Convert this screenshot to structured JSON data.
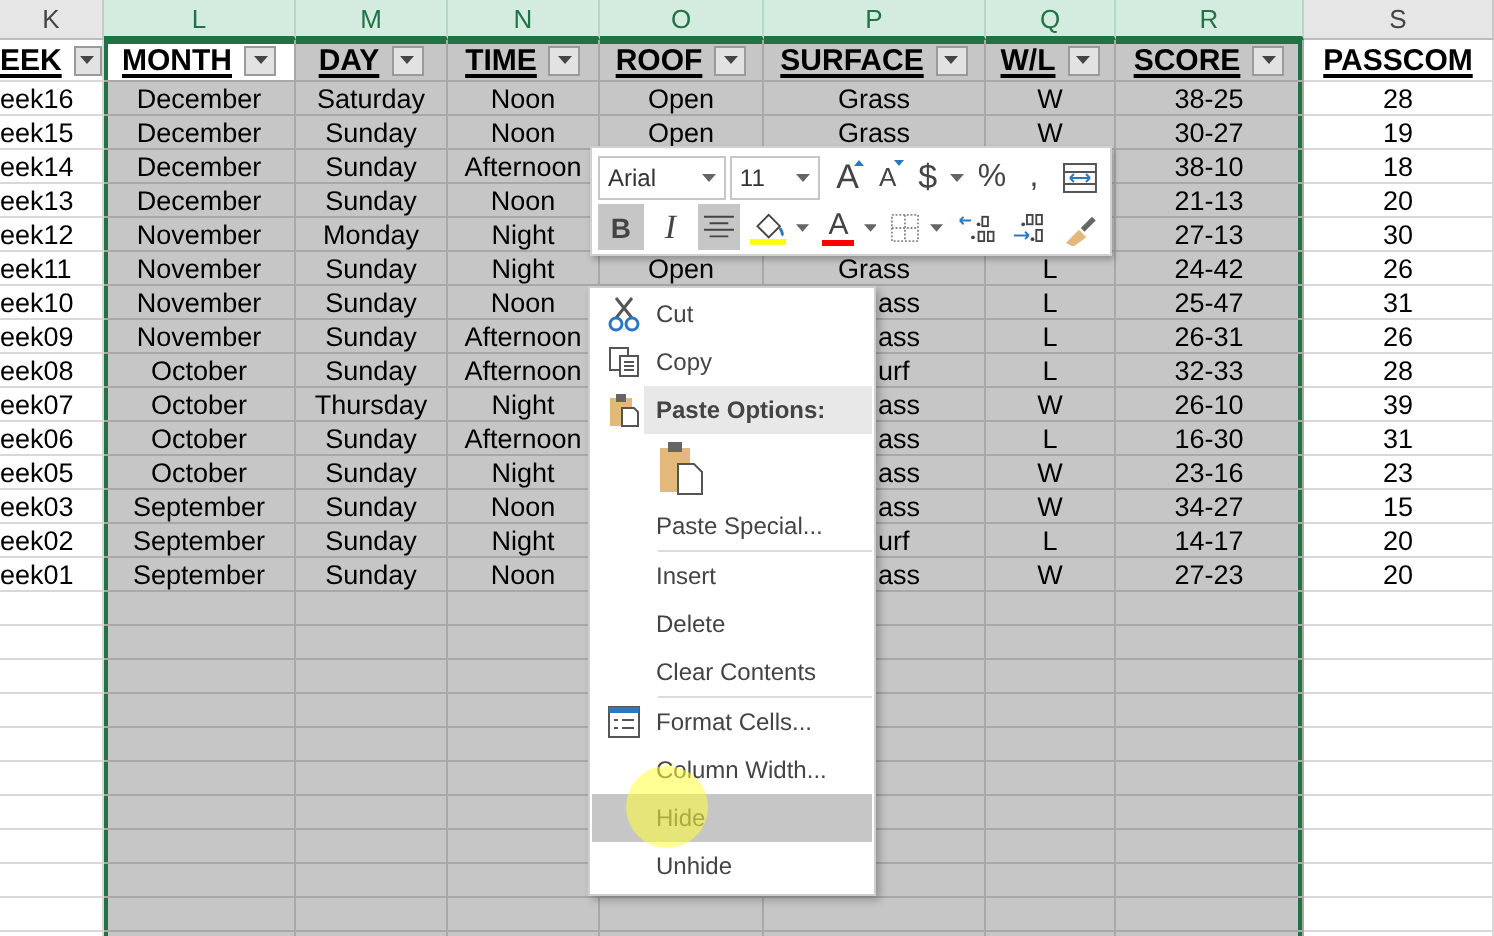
{
  "columns": [
    {
      "letter": "K",
      "selected": false
    },
    {
      "letter": "L",
      "selected": true
    },
    {
      "letter": "M",
      "selected": true
    },
    {
      "letter": "N",
      "selected": true
    },
    {
      "letter": "O",
      "selected": true
    },
    {
      "letter": "P",
      "selected": true
    },
    {
      "letter": "Q",
      "selected": true
    },
    {
      "letter": "R",
      "selected": true
    },
    {
      "letter": "S",
      "selected": false
    }
  ],
  "headers": [
    {
      "title": "EEK",
      "filter": true,
      "active": false
    },
    {
      "title": "MONTH",
      "filter": true,
      "active": true
    },
    {
      "title": "DAY",
      "filter": true,
      "active": false
    },
    {
      "title": "TIME",
      "filter": true,
      "active": false
    },
    {
      "title": "ROOF",
      "filter": true,
      "active": false
    },
    {
      "title": "SURFACE",
      "filter": true,
      "active": false
    },
    {
      "title": "W/L",
      "filter": true,
      "active": false
    },
    {
      "title": "SCORE",
      "filter": true,
      "active": false
    },
    {
      "title": "PASSCOM",
      "filter": false,
      "active": false
    }
  ],
  "rows": [
    [
      "eek16",
      "December",
      "Saturday",
      "Noon",
      "Open",
      "Grass",
      "W",
      "38-25",
      "28"
    ],
    [
      "eek15",
      "December",
      "Sunday",
      "Noon",
      "Open",
      "Grass",
      "W",
      "30-27",
      "19"
    ],
    [
      "eek14",
      "December",
      "Sunday",
      "Afternoon",
      "",
      "",
      "",
      "38-10",
      "18"
    ],
    [
      "eek13",
      "December",
      "Sunday",
      "Noon",
      "",
      "",
      "",
      "21-13",
      "20"
    ],
    [
      "eek12",
      "November",
      "Monday",
      "Night",
      "",
      "",
      "",
      "27-13",
      "30"
    ],
    [
      "eek11",
      "November",
      "Sunday",
      "Night",
      "Open",
      "Grass",
      "L",
      "24-42",
      "26"
    ],
    [
      "eek10",
      "November",
      "Sunday",
      "Noon",
      "",
      "ass",
      "L",
      "25-47",
      "31"
    ],
    [
      "eek09",
      "November",
      "Sunday",
      "Afternoon",
      "",
      "ass",
      "L",
      "26-31",
      "26"
    ],
    [
      "eek08",
      "October",
      "Sunday",
      "Afternoon",
      "",
      "urf",
      "L",
      "32-33",
      "28"
    ],
    [
      "eek07",
      "October",
      "Thursday",
      "Night",
      "",
      "ass",
      "W",
      "26-10",
      "39"
    ],
    [
      "eek06",
      "October",
      "Sunday",
      "Afternoon",
      "",
      "ass",
      "L",
      "16-30",
      "31"
    ],
    [
      "eek05",
      "October",
      "Sunday",
      "Night",
      "",
      "ass",
      "W",
      "23-16",
      "23"
    ],
    [
      "eek03",
      "September",
      "Sunday",
      "Noon",
      "",
      "ass",
      "W",
      "34-27",
      "15"
    ],
    [
      "eek02",
      "September",
      "Sunday",
      "Night",
      "",
      "urf",
      "L",
      "14-17",
      "20"
    ],
    [
      "eek01",
      "September",
      "Sunday",
      "Noon",
      "",
      "ass",
      "W",
      "27-23",
      "20"
    ]
  ],
  "mini_toolbar": {
    "font": "Arial",
    "size": "11",
    "row_1": [
      {
        "kind": "grow",
        "text": "A",
        "selected": false
      },
      {
        "kind": "shrink",
        "text": "A",
        "selected": false
      },
      {
        "kind": "currency",
        "text": "$",
        "selected": false
      },
      {
        "kind": "glyph",
        "text": "%",
        "selected": false
      },
      {
        "kind": "glyph",
        "text": ",",
        "selected": false
      },
      {
        "kind": "wrap",
        "selected": false
      }
    ],
    "row_2": [
      {
        "kind": "bold",
        "text": "B",
        "selected": true
      },
      {
        "kind": "italic",
        "text": "I",
        "selected": false
      },
      {
        "kind": "center",
        "selected": true
      },
      {
        "kind": "fill",
        "selected": false
      },
      {
        "kind": "fontcolor",
        "text": "A",
        "selected": false
      },
      {
        "kind": "borders",
        "selected": false
      },
      {
        "kind": "incdec",
        "selected": false
      },
      {
        "kind": "decdec",
        "selected": false
      },
      {
        "kind": "painter",
        "selected": false
      }
    ]
  },
  "context_menu": [
    {
      "kind": "cut",
      "label": "Cut",
      "selected": false
    },
    {
      "kind": "copy",
      "label": "Copy",
      "selected": false
    },
    {
      "kind": "pasteheader",
      "label": "Paste Options:",
      "selected": false
    },
    {
      "kind": "pasteoption",
      "selected": false
    },
    {
      "kind": "plain",
      "label": "Paste Special...",
      "selected": false
    },
    {
      "kind": "separator"
    },
    {
      "kind": "plain",
      "label": "Insert",
      "selected": false
    },
    {
      "kind": "plain",
      "label": "Delete",
      "selected": false
    },
    {
      "kind": "plain",
      "label": "Clear Contents",
      "selected": false
    },
    {
      "kind": "separator"
    },
    {
      "kind": "format",
      "label": "Format Cells...",
      "selected": false
    },
    {
      "kind": "plain",
      "label": "Column Width...",
      "selected": false
    },
    {
      "kind": "plain",
      "label": "Hide",
      "selected": true
    },
    {
      "kind": "plain",
      "label": "Unhide",
      "selected": false
    }
  ]
}
